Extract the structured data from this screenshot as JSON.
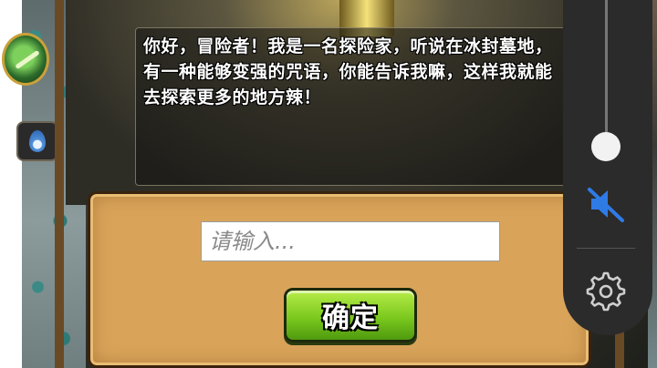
{
  "dialog": {
    "text": "你好，冒险者！我是一名探险家，听说在冰封墓地，有一种能够变强的咒语，你能告诉我嘛，这样我就能去探索更多的地方辣！"
  },
  "answer_input": {
    "placeholder": "请输入...",
    "value": ""
  },
  "confirm_button": {
    "label": "确定"
  },
  "overlay": {
    "volume_slider_level_percent": 9,
    "mute_icon": "speaker-muted-icon",
    "settings_icon": "gear-icon",
    "accent_color": "#2f7be6"
  },
  "colors": {
    "parchment": "#d9a45a",
    "button_green": "#7bc91e",
    "overlay_bg": "#2b2b2b"
  }
}
